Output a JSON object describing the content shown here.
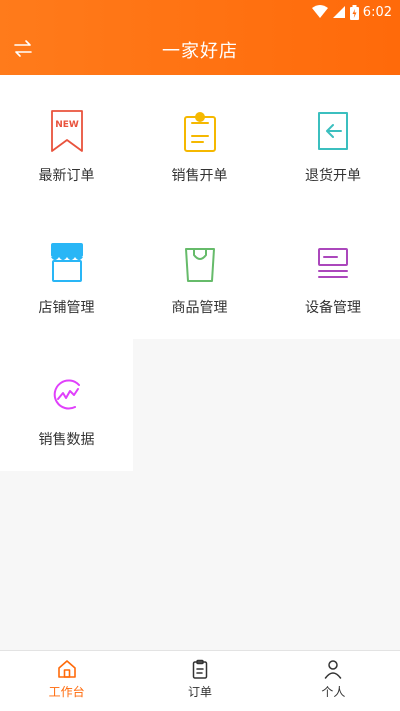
{
  "status": {
    "time": "6:02"
  },
  "header": {
    "title": "一家好店"
  },
  "menu": [
    {
      "label": "最新订单",
      "icon": "new-order-icon",
      "badge": "NEW",
      "color": "#e9533d"
    },
    {
      "label": "销售开单",
      "icon": "sales-order-icon",
      "color": "#f5b800"
    },
    {
      "label": "退货开单",
      "icon": "return-order-icon",
      "color": "#3bbfbf"
    },
    {
      "label": "店铺管理",
      "icon": "store-icon",
      "color": "#29b6f6"
    },
    {
      "label": "商品管理",
      "icon": "shopping-bag-icon",
      "color": "#66bb6a"
    },
    {
      "label": "设备管理",
      "icon": "device-icon",
      "color": "#ab47bc"
    },
    {
      "label": "销售数据",
      "icon": "sales-chart-icon",
      "color": "#e040fb"
    }
  ],
  "tabs": [
    {
      "label": "工作台",
      "icon": "home-icon",
      "active": true
    },
    {
      "label": "订单",
      "icon": "clipboard-icon",
      "active": false
    },
    {
      "label": "个人",
      "icon": "user-icon",
      "active": false
    }
  ],
  "colors": {
    "accent": "#ff6a0a",
    "tab_active": "#ff6a0a",
    "tab_inactive": "#333333"
  }
}
